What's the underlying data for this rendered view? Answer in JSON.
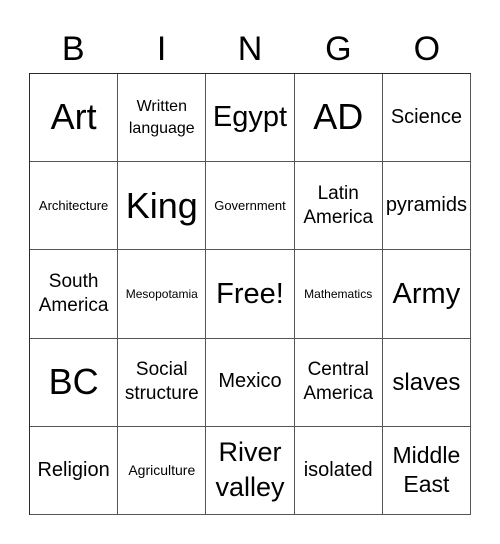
{
  "card": {
    "header_letters": [
      "B",
      "I",
      "N",
      "G",
      "O"
    ],
    "rows": [
      [
        "Art",
        "Written language",
        "Egypt",
        "AD",
        "Science"
      ],
      [
        "Architecture",
        "King",
        "Government",
        "Latin America",
        "pyramids"
      ],
      [
        "South America",
        "Mesopotamia",
        "Free!",
        "Mathematics",
        "Army"
      ],
      [
        "BC",
        "Social structure",
        "Mexico",
        "Central America",
        "slaves"
      ],
      [
        "Religion",
        "Agriculture",
        "River valley",
        "isolated",
        "Middle East"
      ]
    ],
    "free_space_label": "Free!"
  }
}
